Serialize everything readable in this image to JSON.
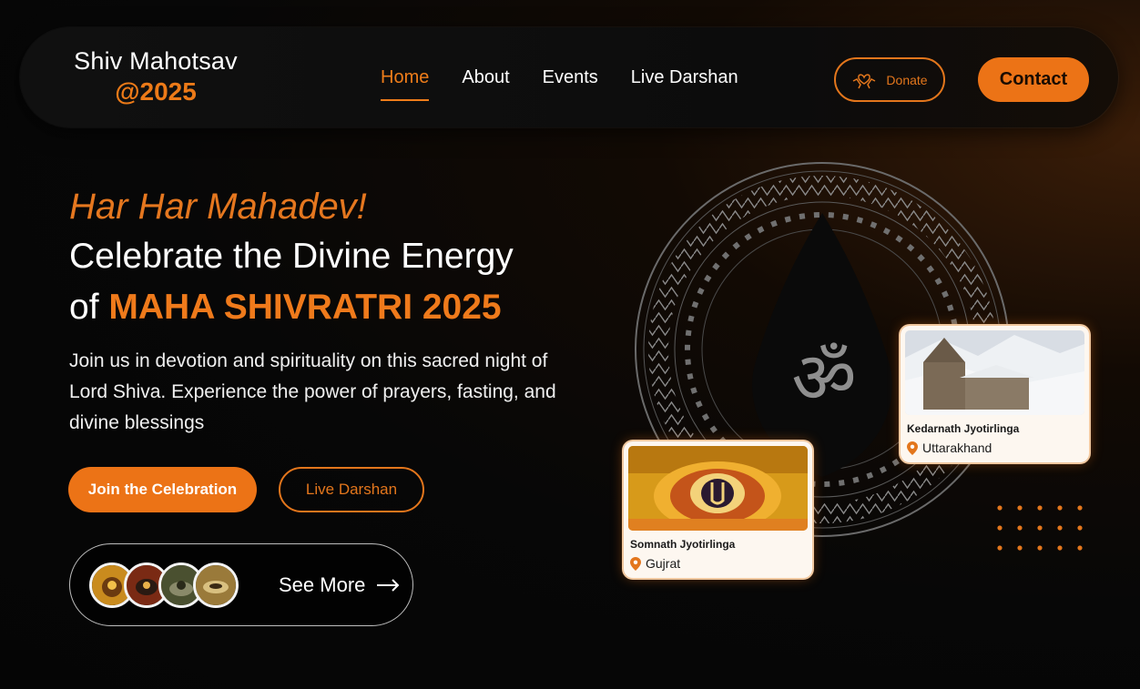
{
  "brand": {
    "title": "Shiv Mahotsav",
    "year": "@2025",
    "accent_color": "#ec7316"
  },
  "nav": {
    "items": [
      {
        "label": "Home",
        "active": true
      },
      {
        "label": "About",
        "active": false
      },
      {
        "label": "Events",
        "active": false
      },
      {
        "label": "Live Darshan",
        "active": false
      }
    ],
    "donate_label": "Donate",
    "donate_icon": "heart-hands-icon",
    "contact_label": "Contact"
  },
  "hero": {
    "tagline": "Har Har Mahadev!",
    "headline_line1": "Celebrate the Divine Energy",
    "headline_prefix": "of ",
    "headline_highlight": "MAHA SHIVRATRI 2025",
    "description": "Join us in devotion and spirituality on this sacred night of Lord Shiva. Experience the power of prayers, fasting, and divine blessings",
    "primary_cta": "Join the Celebration",
    "secondary_cta": "Live Darshan",
    "see_more_label": "See More",
    "see_more_icon": "arrow-right-icon"
  },
  "cards": [
    {
      "title": "Kedarnath Jyotirlinga",
      "location": "Uttarakhand",
      "icon": "location-pin-icon"
    },
    {
      "title": "Somnath Jyotirlinga",
      "location": "Gujrat",
      "icon": "location-pin-icon"
    }
  ],
  "decor": {
    "om_icon": "om-icon",
    "mandala": "mandala-ring"
  }
}
